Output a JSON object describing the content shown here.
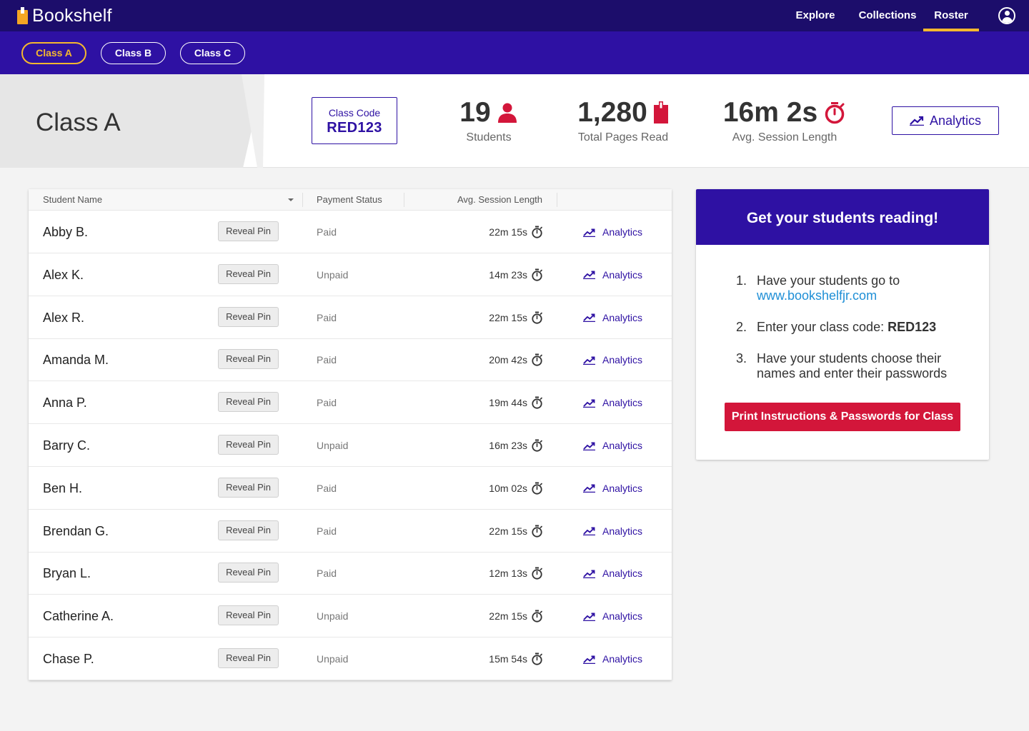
{
  "app": {
    "name": "Bookshelf"
  },
  "nav": {
    "explore": "Explore",
    "collections": "Collections",
    "roster": "Roster"
  },
  "classes": [
    "Class A",
    "Class B",
    "Class C"
  ],
  "summary": {
    "title": "Class A",
    "class_code_label": "Class Code",
    "class_code": "RED123",
    "students_value": "19",
    "students_label": "Students",
    "pages_value": "1,280",
    "pages_label": "Total Pages Read",
    "session_value": "16m 2s",
    "session_label": "Avg. Session Length",
    "analytics_label": "Analytics"
  },
  "table": {
    "headers": {
      "name": "Student Name",
      "payment": "Payment Status",
      "session": "Avg. Session Length"
    },
    "reveal_label": "Reveal Pin",
    "analytics_label": "Analytics",
    "rows": [
      {
        "name": "Abby B.",
        "payment": "Paid",
        "session": "22m 15s"
      },
      {
        "name": "Alex K.",
        "payment": "Unpaid",
        "session": "14m 23s"
      },
      {
        "name": "Alex R.",
        "payment": "Paid",
        "session": "22m 15s"
      },
      {
        "name": "Amanda M.",
        "payment": "Paid",
        "session": "20m 42s"
      },
      {
        "name": "Anna P.",
        "payment": "Paid",
        "session": "19m 44s"
      },
      {
        "name": "Barry C.",
        "payment": "Unpaid",
        "session": "16m 23s"
      },
      {
        "name": "Ben H.",
        "payment": "Paid",
        "session": "10m 02s"
      },
      {
        "name": "Brendan G.",
        "payment": "Paid",
        "session": "22m 15s"
      },
      {
        "name": "Bryan L.",
        "payment": "Paid",
        "session": "12m 13s"
      },
      {
        "name": "Catherine A.",
        "payment": "Unpaid",
        "session": "22m 15s"
      },
      {
        "name": "Chase P.",
        "payment": "Unpaid",
        "session": "15m 54s"
      }
    ]
  },
  "instructions": {
    "heading": "Get your students reading!",
    "step1_text": "Have your students go to",
    "step1_link": "www.bookshelfjr.com",
    "step2_text": "Enter your class code:",
    "step2_code": "RED123",
    "step3_text": "Have your students choose their names and enter their passwords",
    "print_label": "Print Instructions & Passwords for Class"
  },
  "colors": {
    "nav_bg": "#1c0d6b",
    "class_bar_bg": "#2e11a3",
    "accent_yellow": "#f5b82e",
    "accent_red": "#d3163a",
    "link_blue": "#1f8fd6"
  }
}
